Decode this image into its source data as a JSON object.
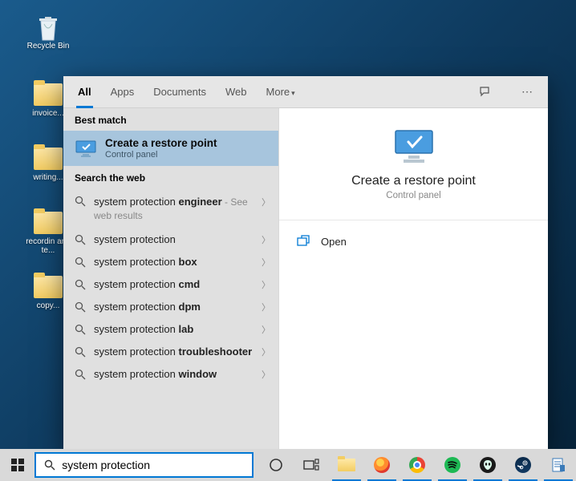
{
  "desktop": {
    "recycle_bin": "Recycle Bin",
    "folders": [
      "invoice...",
      "writing...",
      "recordin and te...",
      "copy..."
    ]
  },
  "search": {
    "tabs": {
      "all": "All",
      "apps": "Apps",
      "documents": "Documents",
      "web": "Web",
      "more": "More"
    },
    "sections": {
      "best_match": "Best match",
      "web": "Search the web"
    },
    "best_match": {
      "title": "Create a restore point",
      "subtitle": "Control panel"
    },
    "web_results": [
      {
        "prefix": "system protection ",
        "bold": "engineer",
        "hint": " - See web results"
      },
      {
        "prefix": "system protection",
        "bold": "",
        "hint": ""
      },
      {
        "prefix": "system protection ",
        "bold": "box",
        "hint": ""
      },
      {
        "prefix": "system protection ",
        "bold": "cmd",
        "hint": ""
      },
      {
        "prefix": "system protection ",
        "bold": "dpm",
        "hint": ""
      },
      {
        "prefix": "system protection ",
        "bold": "lab",
        "hint": ""
      },
      {
        "prefix": "system protection ",
        "bold": "troubleshooter",
        "hint": ""
      },
      {
        "prefix": "system protection ",
        "bold": "window",
        "hint": ""
      }
    ],
    "preview": {
      "title": "Create a restore point",
      "subtitle": "Control panel",
      "open": "Open"
    },
    "query": "system protection"
  }
}
